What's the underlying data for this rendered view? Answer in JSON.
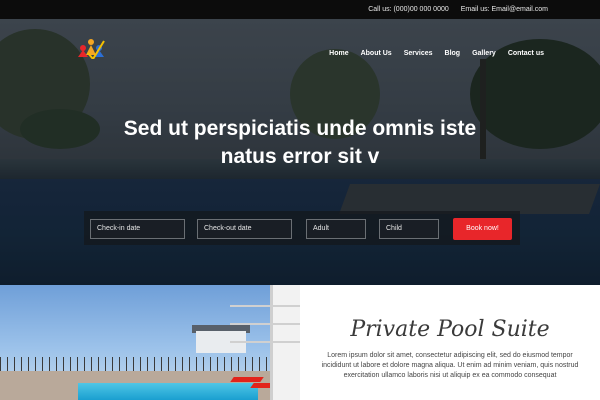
{
  "topbar": {
    "call": "Call us: (000)00 000 0000",
    "email": "Email us: Email@email.com"
  },
  "nav": {
    "items": [
      "Home",
      "About Us",
      "Services",
      "Blog",
      "Gallery",
      "Contact us"
    ]
  },
  "hero": {
    "title_line1": "Sed ut perspiciatis unde omnis iste",
    "title_line2": "natus error sit v"
  },
  "booking": {
    "checkin_placeholder": "Check-in date",
    "checkout_placeholder": "Check-out date",
    "adult_placeholder": "Adult",
    "child_placeholder": "Child",
    "button_label": "Book now!"
  },
  "suite": {
    "title": "Private Pool Suite",
    "description": "Lorem ipsum dolor sit amet, consectetur adipiscing elit, sed do eiusmod tempor incididunt ut labore et dolore magna aliqua. Ut enim ad minim veniam, quis nostrud exercitation ullamco laboris nisi ut aliquip ex ea commodo consequat"
  },
  "colors": {
    "accent": "#e8262a",
    "topbar_bg": "#0c0c0c"
  }
}
